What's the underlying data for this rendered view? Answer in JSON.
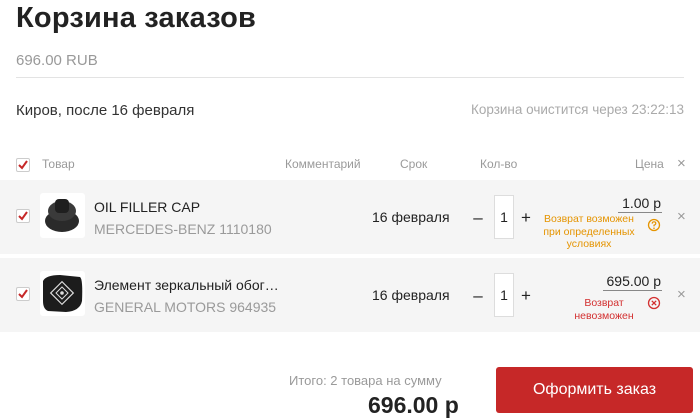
{
  "page": {
    "title": "Корзина заказов",
    "subtotal": "696.00 RUB",
    "city": "Киров, после 16 февраля",
    "timer": "Корзина очистится через 23:22:13"
  },
  "table": {
    "headers": {
      "product": "Товар",
      "comment": "Комментарий",
      "term": "Срок",
      "qty": "Кол-во",
      "price": "Цена"
    }
  },
  "items": [
    {
      "name": "OIL FILLER CAP",
      "brand": "MERCEDES-BENZ 1110180",
      "term": "16 февраля",
      "qty": "1",
      "price": "1.00 р",
      "return_line1": "Возврат возможен",
      "return_line2": "при определенных",
      "return_line3": "условиях",
      "return_color": "#e59400"
    },
    {
      "name": "Элемент зеркальный обог…",
      "brand": "GENERAL MOTORS 964935",
      "term": "16 февраля",
      "qty": "1",
      "price": "695.00 р",
      "return_line1": "Возврат",
      "return_line2": "невозможен",
      "return_color": "#d32f2f"
    }
  ],
  "summary": {
    "label": "Итого: 2 товара на сумму",
    "total": "696.00 р",
    "checkout_label": "Оформить заказ"
  },
  "controls": {
    "minus": "–",
    "plus": "+",
    "remove": "×"
  },
  "colors": {
    "accent": "#c62828",
    "row_bg": "#f5f5f5",
    "muted": "#9a9a9a"
  }
}
